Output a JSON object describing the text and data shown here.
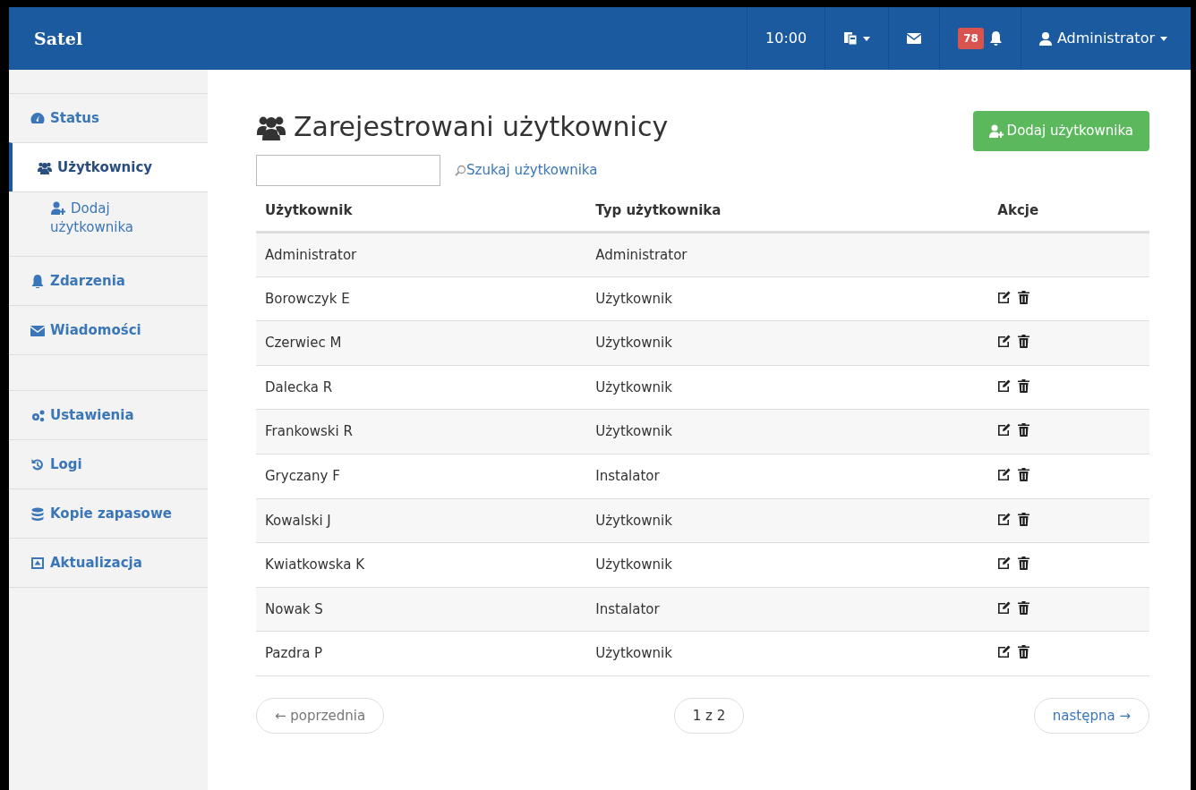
{
  "navbar": {
    "logo": "Satel",
    "time": "10:00",
    "notification_count": "78",
    "user": "Administrator"
  },
  "sidebar": {
    "items": [
      {
        "kind": "item",
        "label": "Status",
        "selected": false
      },
      {
        "kind": "item",
        "label": "Użytkownicy",
        "selected": true
      },
      {
        "kind": "subitem",
        "label": "Dodaj użytkownika",
        "selected": false
      },
      {
        "kind": "item",
        "label": "Zdarzenia",
        "selected": false
      },
      {
        "kind": "item",
        "label": "Wiadomości",
        "selected": false
      },
      {
        "kind": "spacer"
      },
      {
        "kind": "item",
        "label": "Ustawienia",
        "selected": false
      },
      {
        "kind": "item",
        "label": "Logi",
        "selected": false
      },
      {
        "kind": "item",
        "label": "Kopie zapasowe",
        "selected": false
      },
      {
        "kind": "item",
        "label": "Aktualizacja",
        "selected": false
      }
    ]
  },
  "page_title": "Zarejestrowani użytkownicy",
  "add_button": "Dodaj użytkownika",
  "search": {
    "link": "Szukaj użytkownika"
  },
  "table": {
    "columns": [
      "Użytkownik",
      "Typ użytkownika",
      "Akcje"
    ],
    "rows": [
      {
        "name": "Administrator",
        "type": "Administrator",
        "actions": false
      },
      {
        "name": "Borowczyk E",
        "type": "Użytkownik",
        "actions": true
      },
      {
        "name": "Czerwiec M",
        "type": "Użytkownik",
        "actions": true
      },
      {
        "name": "Dalecka R",
        "type": "Użytkownik",
        "actions": true
      },
      {
        "name": "Frankowski R",
        "type": "Użytkownik",
        "actions": true
      },
      {
        "name": "Gryczany F",
        "type": "Instalator",
        "actions": true
      },
      {
        "name": "Kowalski J",
        "type": "Użytkownik",
        "actions": true
      },
      {
        "name": "Kwiatkowska K",
        "type": "Użytkownik",
        "actions": true
      },
      {
        "name": "Nowak S",
        "type": "Instalator",
        "actions": true
      },
      {
        "name": "Pazdra P",
        "type": "Użytkownik",
        "actions": true
      }
    ]
  },
  "pager": {
    "previous": {
      "label": "← poprzednia",
      "disabled": true
    },
    "page": "1 z 2",
    "next": {
      "label": "następna →",
      "disabled": false
    }
  }
}
